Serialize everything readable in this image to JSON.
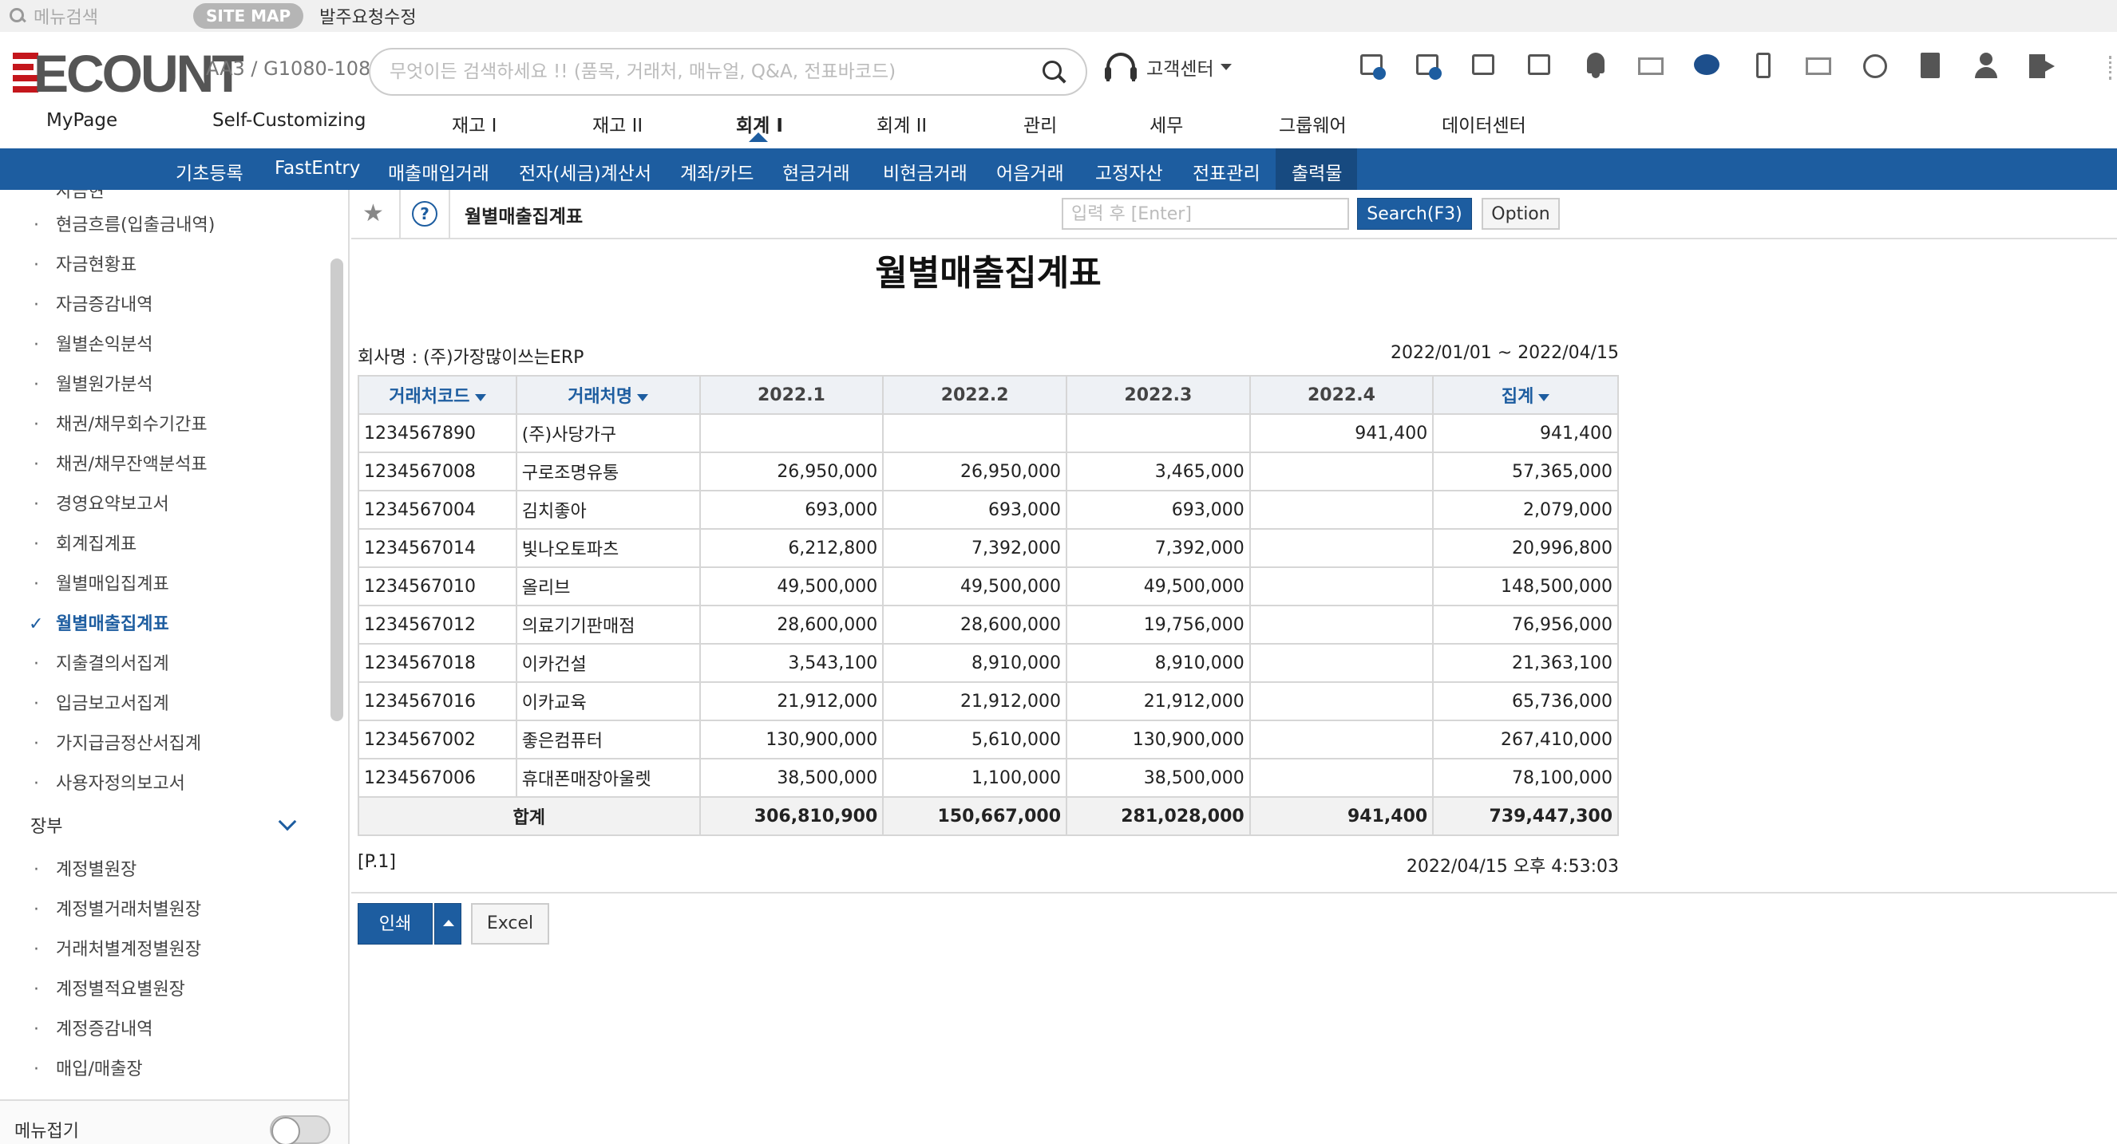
{
  "topbar": {
    "menu_search_placeholder": "메뉴검색",
    "sitemap": "SITE MAP",
    "breadcrumb": "발주요청수정"
  },
  "header": {
    "logo": "ECOUNT",
    "company_code": "AA3 / G1080-108",
    "search_placeholder": "무엇이든 검색하세요 !! (품목, 거래처, 매뉴얼, Q&A, 전표바코드)",
    "customer_center": "고객센터",
    "icons": [
      "monitor-icon",
      "add-window-icon",
      "transfer-icon",
      "list-icon",
      "bell-icon",
      "mail-send-icon",
      "chat-icon",
      "mobile-icon",
      "envelope-icon",
      "clock-icon",
      "bookmark-icon",
      "user-icon",
      "logout-icon"
    ]
  },
  "main_nav": [
    "MyPage",
    "Self-Customizing",
    "재고 I",
    "재고 II",
    "회계 I",
    "회계 II",
    "관리",
    "세무",
    "그룹웨어",
    "데이터센터"
  ],
  "main_nav_active": "회계 I",
  "sub_nav": [
    "기초등록",
    "FastEntry",
    "매출매입거래",
    "전자(세금)계산서",
    "계좌/카드",
    "현금거래",
    "비현금거래",
    "어음거래",
    "고정자산",
    "전표관리",
    "출력물"
  ],
  "sub_nav_active": "출력물",
  "sidebar": {
    "partial_top": "자금현",
    "items": [
      "현금흐름(입출금내역)",
      "자금현황표",
      "자금증감내역",
      "월별손익분석",
      "월별원가분석",
      "채권/채무회수기간표",
      "채권/채무잔액분석표",
      "경영요약보고서",
      "회계집계표",
      "월별매입집계표",
      "월별매출집계표",
      "지출결의서집계",
      "입금보고서집계",
      "가지급금정산서집계",
      "사용자정의보고서"
    ],
    "selected": "월별매출집계표",
    "section": "장부",
    "section_items": [
      "계정별원장",
      "계정별거래처별원장",
      "거래처별계정별원장",
      "계정별적요별원장",
      "계정증감내역",
      "매입/매출장"
    ],
    "footer_label": "메뉴접기"
  },
  "toolbar": {
    "title": "월별매출집계표",
    "search_placeholder": "입력 후 [Enter]",
    "search_button": "Search(F3)",
    "option_button": "Option",
    "help": "?"
  },
  "report": {
    "title": "월별매출집계표",
    "company": "회사명 : (주)가장많이쓰는ERP",
    "period": "2022/01/01 ~ 2022/04/15",
    "columns": [
      "거래처코드",
      "거래처명",
      "2022.1",
      "2022.2",
      "2022.3",
      "2022.4",
      "집계"
    ],
    "rows": [
      [
        "1234567890",
        "(주)사당가구",
        "",
        "",
        "",
        "941,400",
        "941,400"
      ],
      [
        "1234567008",
        "구로조명유통",
        "26,950,000",
        "26,950,000",
        "3,465,000",
        "",
        "57,365,000"
      ],
      [
        "1234567004",
        "김치좋아",
        "693,000",
        "693,000",
        "693,000",
        "",
        "2,079,000"
      ],
      [
        "1234567014",
        "빛나오토파츠",
        "6,212,800",
        "7,392,000",
        "7,392,000",
        "",
        "20,996,800"
      ],
      [
        "1234567010",
        "올리브",
        "49,500,000",
        "49,500,000",
        "49,500,000",
        "",
        "148,500,000"
      ],
      [
        "1234567012",
        "의료기기판매점",
        "28,600,000",
        "28,600,000",
        "19,756,000",
        "",
        "76,956,000"
      ],
      [
        "1234567018",
        "이카건설",
        "3,543,100",
        "8,910,000",
        "8,910,000",
        "",
        "21,363,100"
      ],
      [
        "1234567016",
        "이카교육",
        "21,912,000",
        "21,912,000",
        "21,912,000",
        "",
        "65,736,000"
      ],
      [
        "1234567002",
        "좋은컴퓨터",
        "130,900,000",
        "5,610,000",
        "130,900,000",
        "",
        "267,410,000"
      ],
      [
        "1234567006",
        "휴대폰매장아울렛",
        "38,500,000",
        "1,100,000",
        "38,500,000",
        "",
        "78,100,000"
      ]
    ],
    "total": {
      "label": "합계",
      "values": [
        "306,810,900",
        "150,667,000",
        "281,028,000",
        "941,400",
        "739,447,300"
      ]
    },
    "page": "[P.1]",
    "printed_at": "2022/04/15 오후 4:53:03"
  },
  "actions": {
    "print": "인쇄",
    "excel": "Excel"
  }
}
